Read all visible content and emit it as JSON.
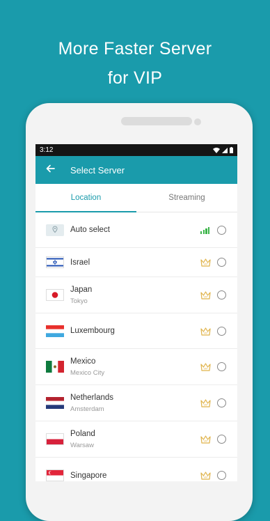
{
  "promo": {
    "line1": "More Faster Server",
    "line2": "for VIP"
  },
  "status_bar": {
    "time": "3:12"
  },
  "app_bar": {
    "title": "Select Server",
    "back_icon": "arrow-left-icon"
  },
  "tabs": [
    {
      "label": "Location",
      "active": true
    },
    {
      "label": "Streaming",
      "active": false
    }
  ],
  "servers": [
    {
      "name": "Auto select",
      "city": "",
      "icon": "location-pin-icon",
      "badge": "signal-icon"
    },
    {
      "name": "Israel",
      "city": "",
      "icon": "israel-flag-icon",
      "badge": "vip-crown-icon"
    },
    {
      "name": "Japan",
      "city": "Tokyo",
      "icon": "japan-flag-icon",
      "badge": "vip-crown-icon"
    },
    {
      "name": "Luxembourg",
      "city": "",
      "icon": "luxembourg-flag-icon",
      "badge": "vip-crown-icon"
    },
    {
      "name": "Mexico",
      "city": "Mexico City",
      "icon": "mexico-flag-icon",
      "badge": "vip-crown-icon"
    },
    {
      "name": "Netherlands",
      "city": "Amsterdam",
      "icon": "netherlands-flag-icon",
      "badge": "vip-crown-icon"
    },
    {
      "name": "Poland",
      "city": "Warsaw",
      "icon": "poland-flag-icon",
      "badge": "vip-crown-icon"
    },
    {
      "name": "Singapore",
      "city": "",
      "icon": "singapore-flag-icon",
      "badge": "vip-crown-icon"
    }
  ],
  "colors": {
    "accent": "#1a9bab",
    "signal": "#3cb54a",
    "crown": "#e0b34a"
  }
}
